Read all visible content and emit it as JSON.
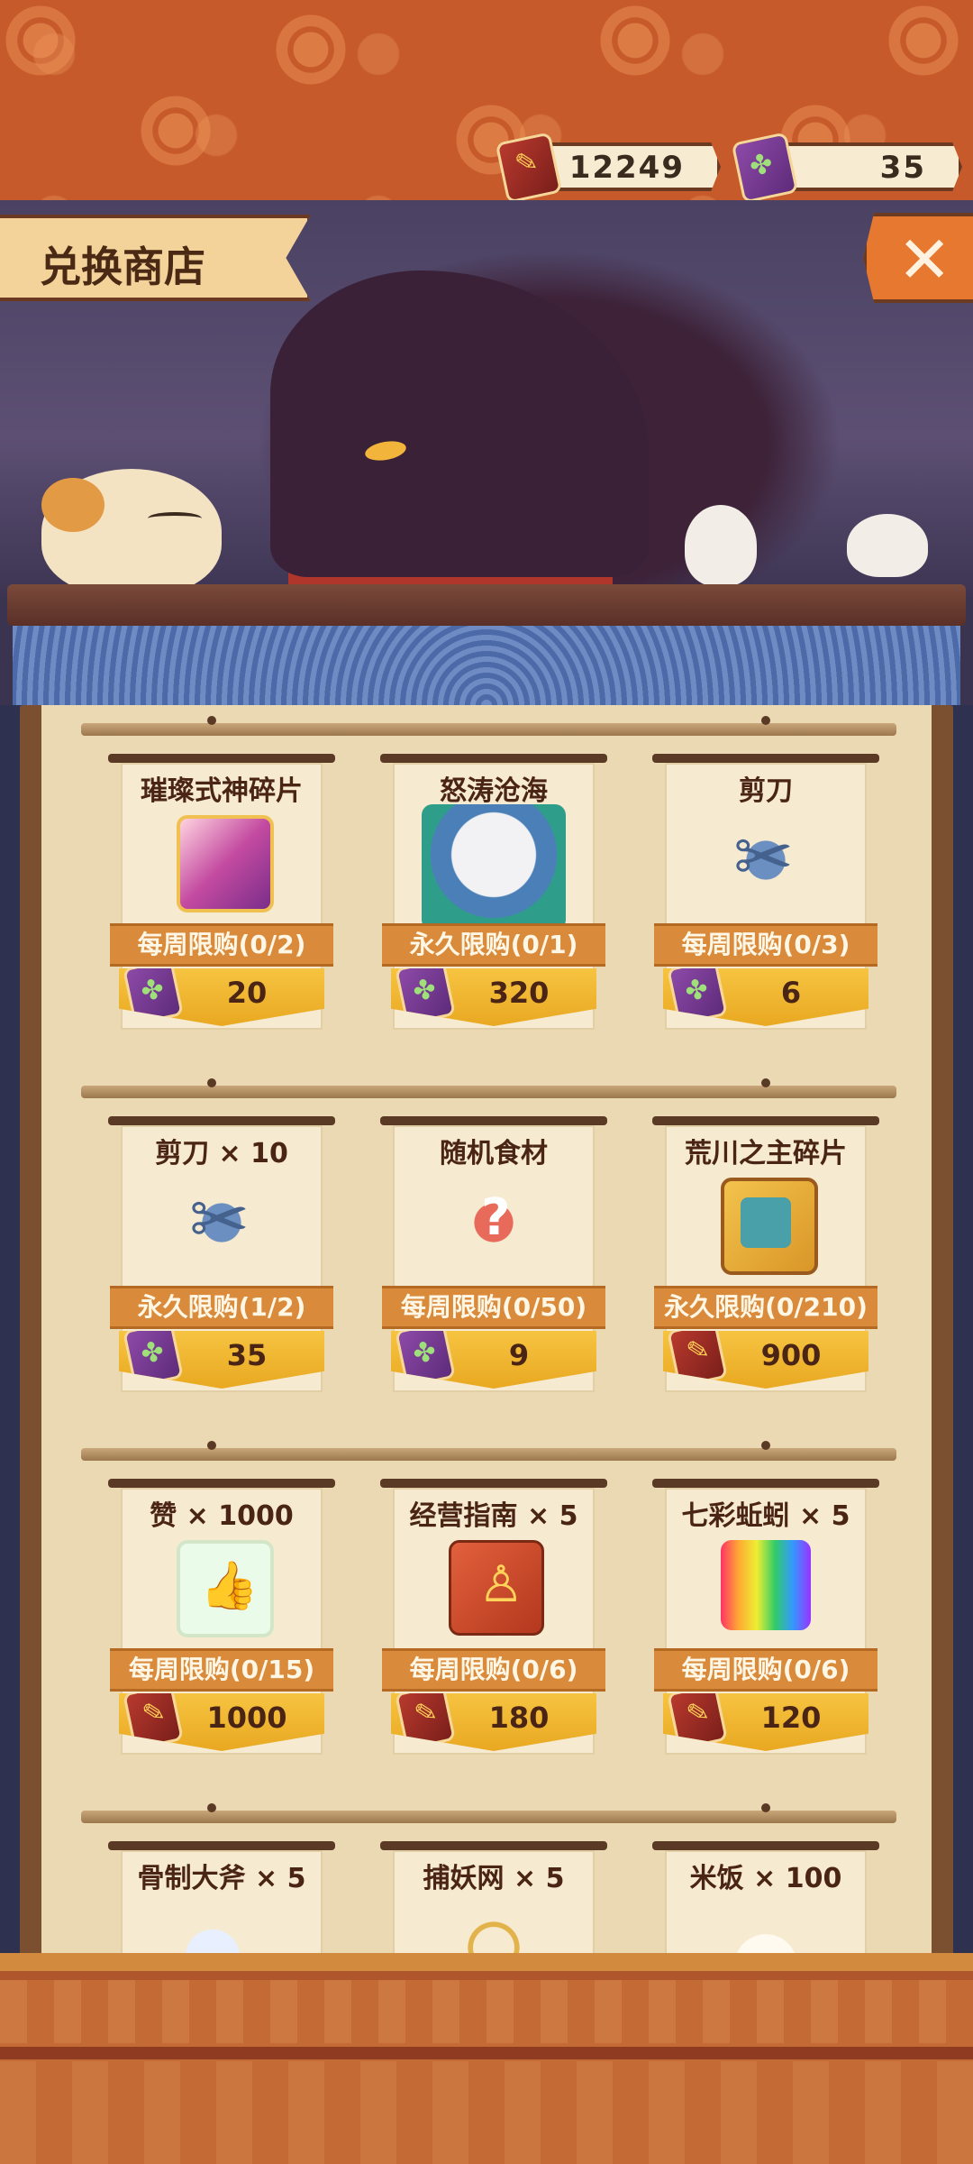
{
  "header": {
    "title": "兑换商店",
    "close_label": "✕"
  },
  "currencies": [
    {
      "icon": "feather-token-icon",
      "value": "12249"
    },
    {
      "icon": "clover-charm-icon",
      "value": "35"
    }
  ],
  "rows": [
    {
      "items": [
        {
          "name": "璀璨式神碎片",
          "limit": "每周限购(0/2)",
          "price": "20",
          "currency": "clover-charm-icon",
          "image": "shikigami-shard-icon"
        },
        {
          "name": "怒涛沧海",
          "limit": "永久限购(0/1)",
          "price": "320",
          "currency": "clover-charm-icon",
          "image": "character-skin-icon"
        },
        {
          "name": "剪刀",
          "limit": "每周限购(0/3)",
          "price": "6",
          "currency": "clover-charm-icon",
          "image": "scissors-icon"
        }
      ]
    },
    {
      "items": [
        {
          "name": "剪刀 × 10",
          "limit": "永久限购(1/2)",
          "price": "35",
          "currency": "clover-charm-icon",
          "image": "scissors-icon"
        },
        {
          "name": "随机食材",
          "limit": "每周限购(0/50)",
          "price": "9",
          "currency": "clover-charm-icon",
          "image": "mystery-meat-icon"
        },
        {
          "name": "荒川之主碎片",
          "limit": "永久限购(0/210)",
          "price": "900",
          "currency": "feather-token-icon",
          "image": "portrait-shard-icon"
        }
      ]
    },
    {
      "items": [
        {
          "name": "赞 × 1000",
          "limit": "每周限购(0/15)",
          "price": "1000",
          "currency": "feather-token-icon",
          "image": "like-cards-icon"
        },
        {
          "name": "经营指南 × 5",
          "limit": "每周限购(0/6)",
          "price": "180",
          "currency": "feather-token-icon",
          "image": "guide-book-icon"
        },
        {
          "name": "七彩蚯蚓 × 5",
          "limit": "每周限购(0/6)",
          "price": "120",
          "currency": "feather-token-icon",
          "image": "rainbow-worm-icon"
        }
      ]
    },
    {
      "items": [
        {
          "name": "骨制大斧 × 5",
          "image": "bone-axe-icon"
        },
        {
          "name": "捕妖网 × 5",
          "image": "catch-net-icon"
        },
        {
          "name": "米饭 × 100",
          "image": "rice-icon"
        }
      ]
    }
  ]
}
